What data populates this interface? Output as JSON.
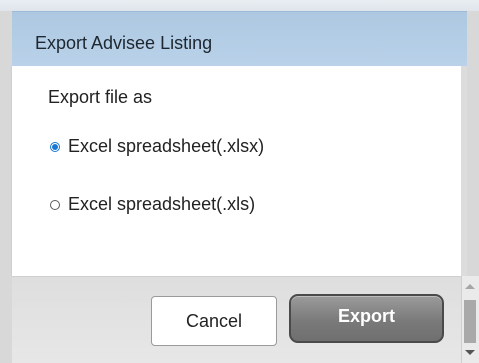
{
  "dialog": {
    "title": "Export Advisee Listing",
    "prompt": "Export file as",
    "options": [
      {
        "label": "Excel spreadsheet(.xlsx)",
        "selected": true
      },
      {
        "label": "Excel spreadsheet(.xls)",
        "selected": false
      }
    ],
    "buttons": {
      "cancel": "Cancel",
      "export": "Export"
    }
  },
  "icons": {
    "selected_radio": "radio-selected-icon",
    "unselected_radio": "radio-unselected-icon",
    "scroll_up": "scroll-up-arrow-icon",
    "scroll_down": "scroll-down-arrow-icon"
  },
  "colors": {
    "title_bar": "#b3cde4",
    "accent": "#1976d2",
    "export_button": "#7f7f7f"
  }
}
